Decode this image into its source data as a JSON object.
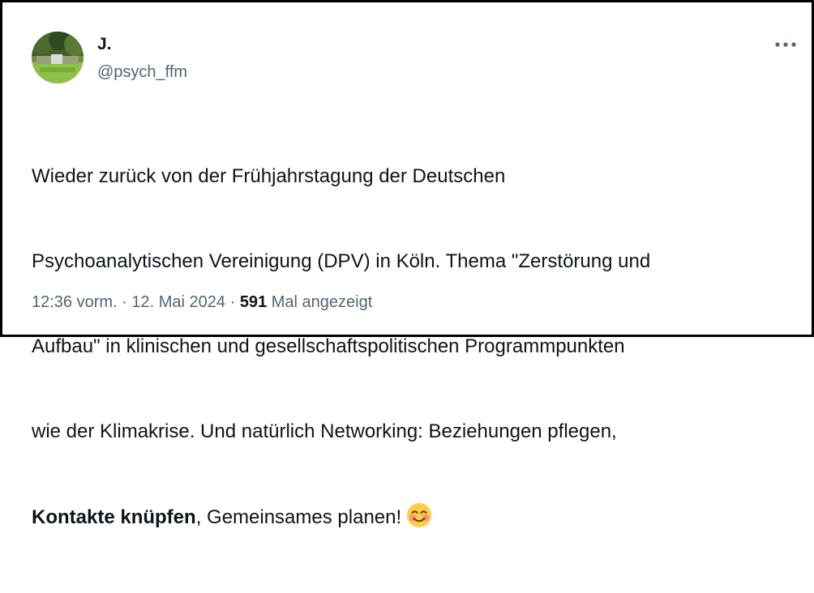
{
  "author": {
    "name": "J.",
    "handle": "@psych_ffm"
  },
  "icons": {
    "more": "more-dots-icon",
    "emoji": "smiling-face-with-smiling-eyes-emoji"
  },
  "tweet": {
    "lines": [
      "Wieder zurück von der Frühjahrstagung der Deutschen",
      "Psychoanalytischen Vereinigung (DPV) in Köln. Thema \"Zerstörung und",
      "Aufbau\" in klinischen und gesellschaftspolitischen Programmpunkten",
      "wie der Klimakrise. Und natürlich Networking: Beziehungen pflegen,"
    ],
    "last_line_bold": "Kontakte knüpfen",
    "last_line_rest": ", Gemeinsames planen!"
  },
  "meta": {
    "time": "12:36 vorm.",
    "separator1": " · ",
    "date": "12. Mai 2024",
    "separator2": " · ",
    "views_count": "591",
    "views_label": " Mal angezeigt"
  },
  "colors": {
    "text": "#0f1419",
    "secondary": "#536471",
    "border": "#000000"
  }
}
